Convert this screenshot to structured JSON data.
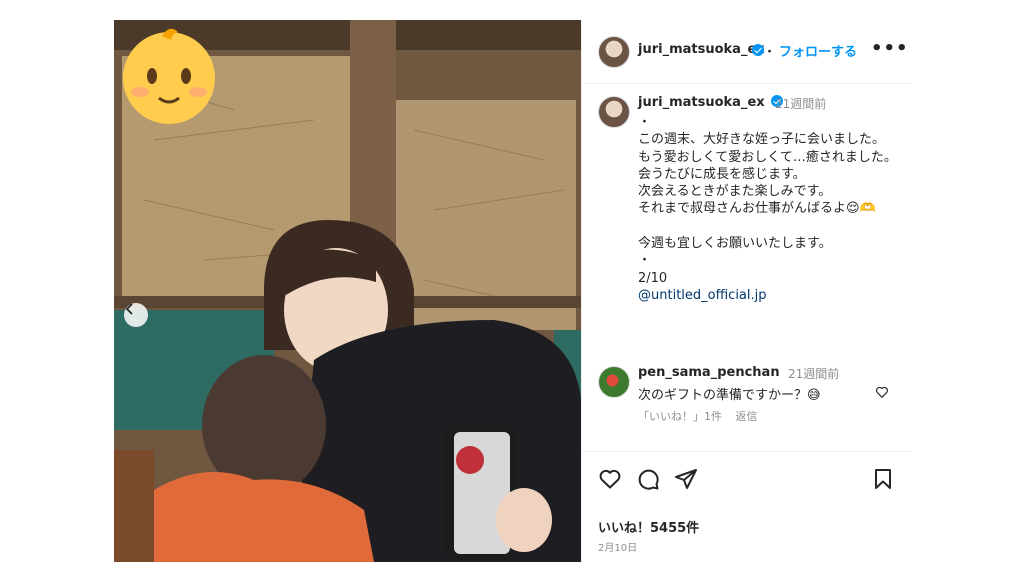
{
  "post": {
    "username": "juri_matsuoka_ex",
    "follow_label": "フォローする",
    "separator": "・",
    "more_label": "•••",
    "caption": {
      "username": "juri_matsuoka_ex",
      "time": "21週間前",
      "lines": [
        "・",
        "この週末、大好きな姪っ子に会いました。",
        "もう愛おしくて愛おしくて…癒されました。",
        "会うたびに成長を感じます。",
        "次会えるときがまた楽しみです。",
        "それまで叔母さんお仕事がんばるよ😌🫶",
        "",
        "今週も宜しくお願いいたします。",
        "・",
        "2/10"
      ],
      "mention": "@untitled_official.jp"
    },
    "reply": {
      "username": "pen_sama_penchan",
      "time": "21週間前",
      "text": "次のギフトの準備ですかー？😅",
      "like_label": "「いいね！」1件",
      "reply_label": "返信"
    },
    "likes": "いいね！5455件",
    "date": "2月10日"
  },
  "icons": {
    "prev": "chevron-left-icon",
    "like": "heart-icon",
    "comment": "comment-icon",
    "share": "paper-plane-icon",
    "save": "bookmark-icon",
    "verified": "verified-badge-icon"
  },
  "colors": {
    "accent": "#0095f6",
    "muted": "#8e8e8e",
    "border": "#efefef",
    "mention": "#00376b"
  }
}
